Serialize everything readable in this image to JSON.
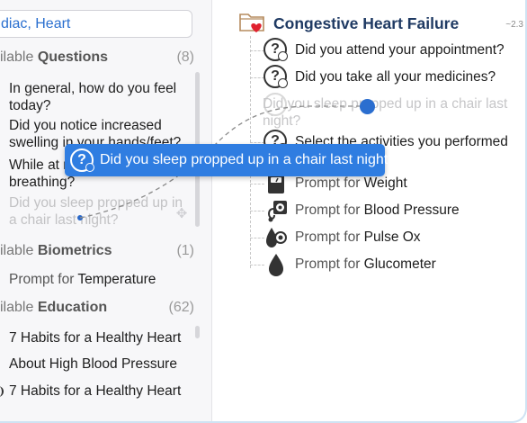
{
  "search": {
    "value": "diac, Heart"
  },
  "left": {
    "questions": {
      "prefix": "ilable ",
      "title": "Questions",
      "count": "(8)",
      "items": [
        "In general, how do you feel today?",
        "Did you notice increased swelling in your hands/feet?",
        "While at rest, do you have breathing?",
        "Did you sleep propped up in a chair last night?"
      ]
    },
    "biometrics": {
      "prefix": "ilable ",
      "title": "Biometrics",
      "count": "(1)",
      "items": [
        {
          "prefix": "Prompt for ",
          "name": "Temperature"
        }
      ]
    },
    "education": {
      "prefix": "ilable ",
      "title": "Education",
      "count": "(62)",
      "items": [
        "7 Habits for a Healthy Heart",
        "About High Blood Pressure",
        "7 Habits for a Healthy Heart"
      ]
    }
  },
  "right": {
    "version": "~2.3",
    "title": "Congestive Heart Failure",
    "questions": [
      "Did you attend your appointment?",
      "Did you take all your medicines?",
      "Select the activities you performed"
    ],
    "ghost_question": "Did you sleep propped up in a chair last night?",
    "biometrics": [
      {
        "prefix": "Prompt for ",
        "name": "Weight",
        "icon": "scale-icon"
      },
      {
        "prefix": "Prompt for ",
        "name": "Blood Pressure",
        "icon": "blood-pressure-icon"
      },
      {
        "prefix": "Prompt for ",
        "name": "Pulse Ox",
        "icon": "pulse-ox-icon"
      },
      {
        "prefix": "Prompt for ",
        "name": "Glucometer",
        "icon": "blood-drop-icon"
      }
    ]
  },
  "drag": {
    "label": "Did you sleep propped up in a chair last night?"
  },
  "colors": {
    "accent": "#2f7de1",
    "title": "#1f3a63",
    "heart": "#e0212f"
  }
}
